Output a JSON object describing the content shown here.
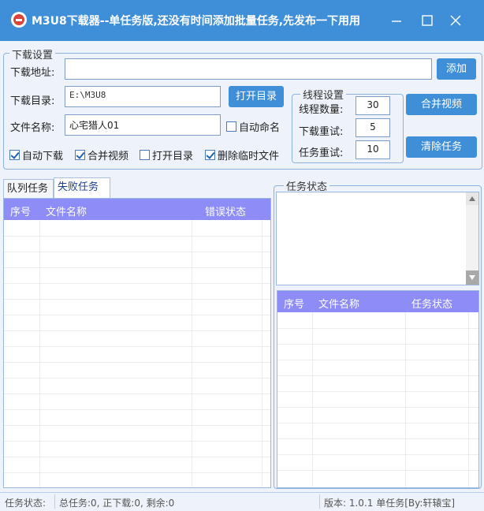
{
  "window": {
    "title": "M3U8下载器--单任务版,还没有时间添加批量任务,先发布一下用用"
  },
  "settings": {
    "group_title": "下载设置",
    "url_label": "下载地址:",
    "url_value": "",
    "add_button": "添加",
    "dir_label": "下载目录:",
    "dir_value": "E:\\M3U8",
    "open_dir_button": "打开目录",
    "name_label": "文件名称:",
    "name_value": "心宅猎人01",
    "auto_name": "自动命名",
    "auto_name_checked": false,
    "checkboxes": [
      {
        "label": "自动下载",
        "checked": true
      },
      {
        "label": "合并视频",
        "checked": true
      },
      {
        "label": "打开目录",
        "checked": false
      },
      {
        "label": "删除临时文件",
        "checked": true
      }
    ]
  },
  "thread": {
    "group_title": "线程设置",
    "count_label": "线程数量:",
    "count_value": "30",
    "retry_label": "下载重试:",
    "retry_value": "5",
    "task_retry_label": "任务重试:",
    "task_retry_value": "10"
  },
  "actions": {
    "merge_button": "合并视频",
    "clear_button": "清除任务"
  },
  "tabs": {
    "queue": "队列任务",
    "failed": "失败任务",
    "active": "failed"
  },
  "failed_table": {
    "columns": [
      "序号",
      "文件名称",
      "错误状态"
    ]
  },
  "task_status": {
    "group_title": "任务状态",
    "log_text": ""
  },
  "task_table": {
    "columns": [
      "序号",
      "文件名称",
      "任务状态"
    ]
  },
  "statusbar": {
    "label": "任务状态:",
    "summary": "总任务:0, 正下载:0, 剩余:0",
    "version": "版本: 1.0.1 单任务[By:轩辕宝]"
  },
  "colors": {
    "titlebar": "#3f8fd8",
    "button": "#3f8fd8",
    "table_header": "#8e8cf6"
  }
}
